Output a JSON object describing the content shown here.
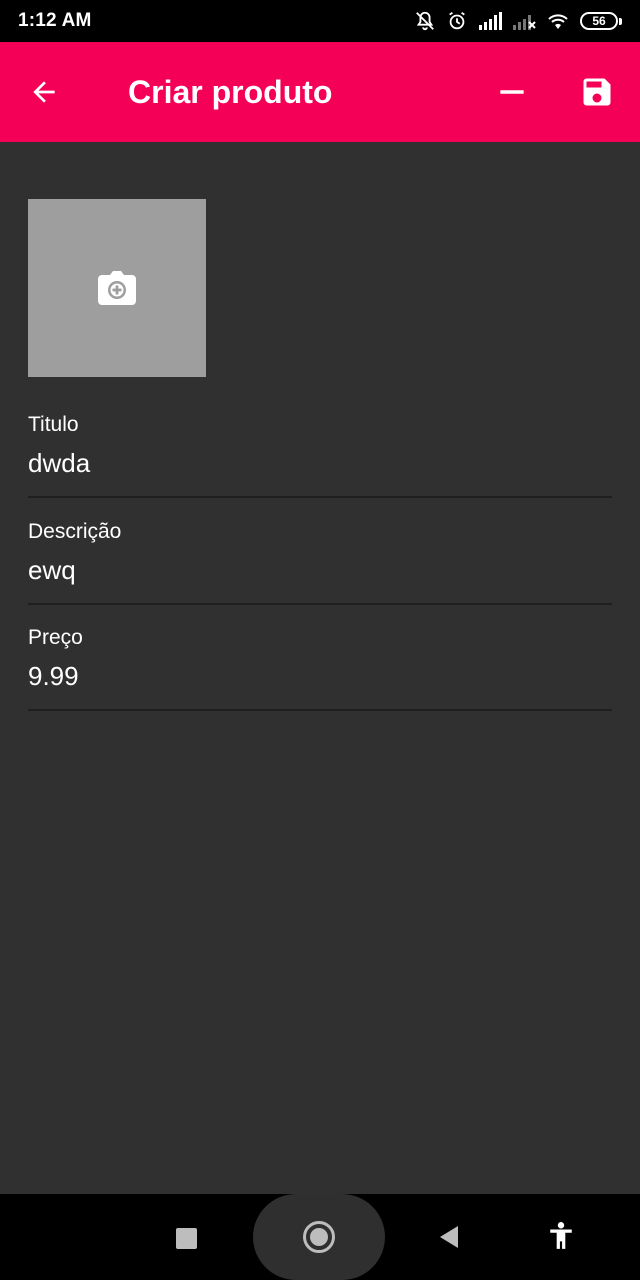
{
  "status_bar": {
    "time": "1:12 AM",
    "battery": "56",
    "icons": [
      "mute-icon",
      "alarm-icon",
      "signal-icon",
      "signal-no-service-icon",
      "wifi-icon",
      "battery-icon"
    ]
  },
  "app_bar": {
    "title": "Criar produto",
    "background": "#f50057",
    "icons": [
      "back-arrow-icon",
      "minus-icon",
      "save-icon"
    ]
  },
  "image_picker": {
    "icon": "add-photo-camera-icon"
  },
  "form": {
    "fields": [
      {
        "label": "Titulo",
        "value": "dwda"
      },
      {
        "label": "Descrição",
        "value": "ewq"
      },
      {
        "label": "Preço",
        "value": "9.99"
      }
    ]
  },
  "nav_bar": {
    "icons": [
      "recents-square-icon",
      "home-circle-icon",
      "back-triangle-icon",
      "accessibility-icon"
    ]
  }
}
